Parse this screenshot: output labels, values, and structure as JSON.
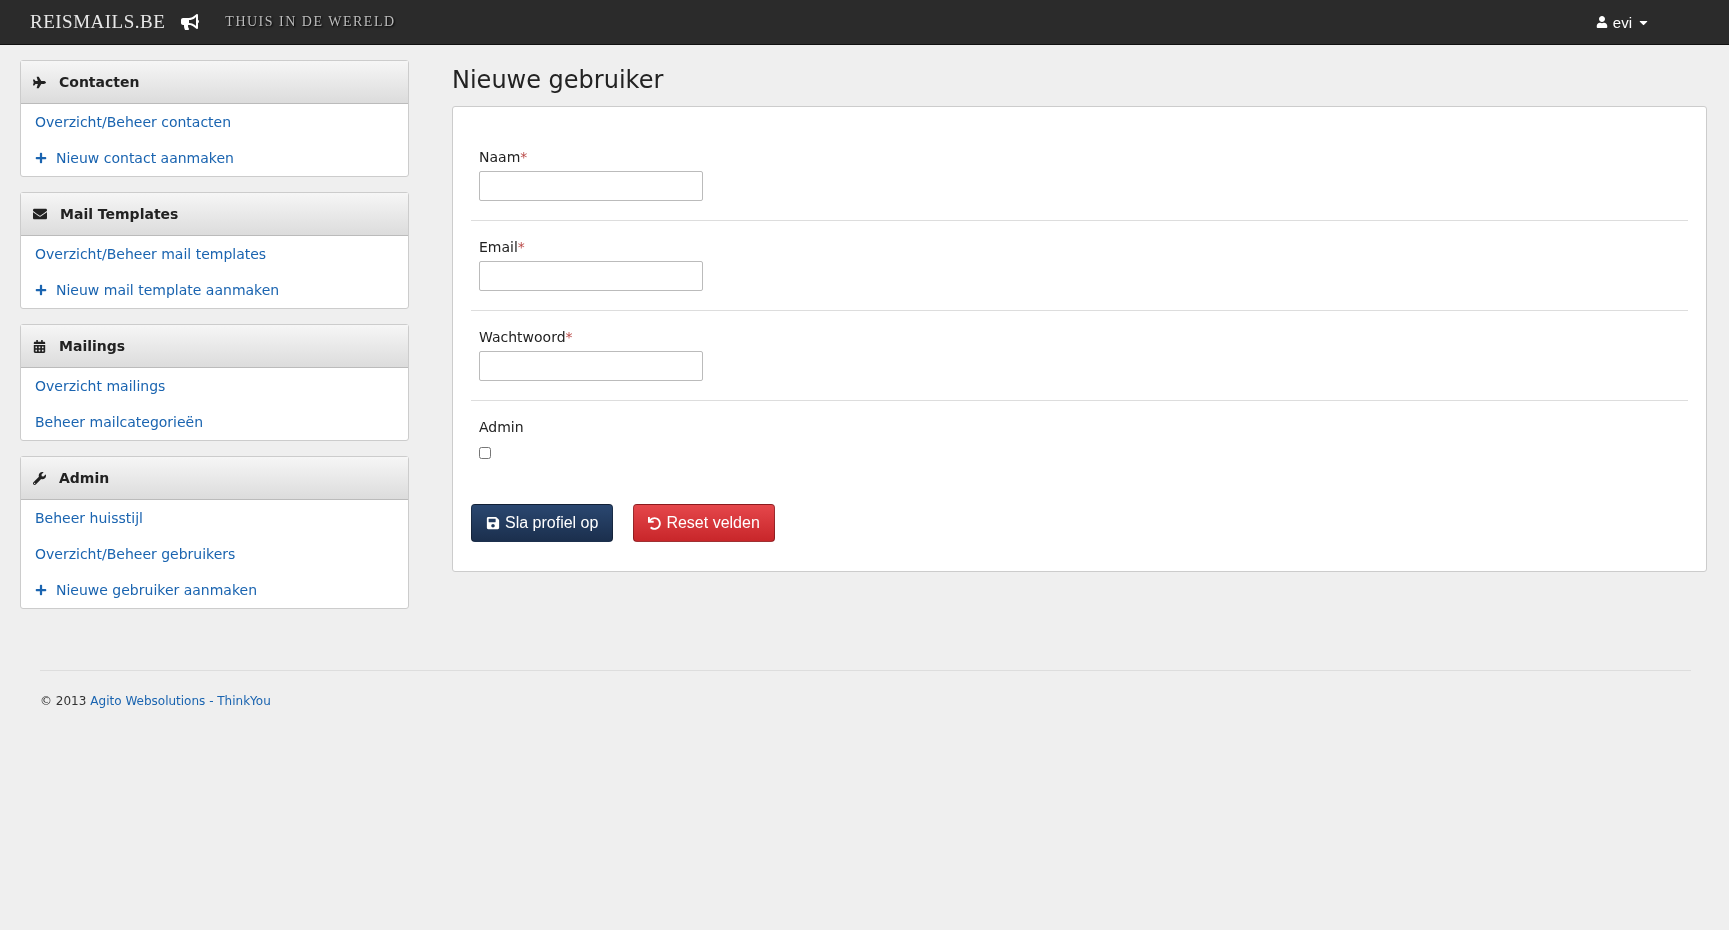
{
  "navbar": {
    "brand": "REISMAILS.BE",
    "tagline": "THUIS IN DE WERELD",
    "user": "evi"
  },
  "sidebar": {
    "sections": [
      {
        "kind": "plane",
        "title": "Contacten",
        "items": [
          {
            "kind": "link",
            "label": "Overzicht/Beheer contacten"
          },
          {
            "kind": "add",
            "label": "Nieuw contact aanmaken"
          }
        ]
      },
      {
        "kind": "envelope",
        "title": "Mail Templates",
        "items": [
          {
            "kind": "link",
            "label": "Overzicht/Beheer mail templates"
          },
          {
            "kind": "add",
            "label": "Nieuw mail template aanmaken"
          }
        ]
      },
      {
        "kind": "calendar",
        "title": "Mailings",
        "items": [
          {
            "kind": "link",
            "label": "Overzicht mailings"
          },
          {
            "kind": "link",
            "label": "Beheer mailcategorieën"
          }
        ]
      },
      {
        "kind": "wrench",
        "title": "Admin",
        "items": [
          {
            "kind": "link",
            "label": "Beheer huisstijl"
          },
          {
            "kind": "link",
            "label": "Overzicht/Beheer gebruikers"
          },
          {
            "kind": "add",
            "label": "Nieuwe gebruiker aanmaken"
          }
        ]
      }
    ]
  },
  "page_title": "Nieuwe gebruiker",
  "form": {
    "fields": [
      {
        "kind": "text",
        "label": "Naam",
        "required_mark": "*"
      },
      {
        "kind": "text",
        "label": "Email",
        "required_mark": "*"
      },
      {
        "kind": "text",
        "label": "Wachtwoord",
        "required_mark": "*"
      },
      {
        "kind": "checkbox",
        "label": "Admin",
        "checked": false
      }
    ],
    "buttons": [
      {
        "kind": "save",
        "label": "Sla profiel op"
      },
      {
        "kind": "reset",
        "label": "Reset velden"
      }
    ]
  },
  "footer": {
    "copyright": "© 2013",
    "link": "Agito Websolutions - ThinkYou"
  }
}
